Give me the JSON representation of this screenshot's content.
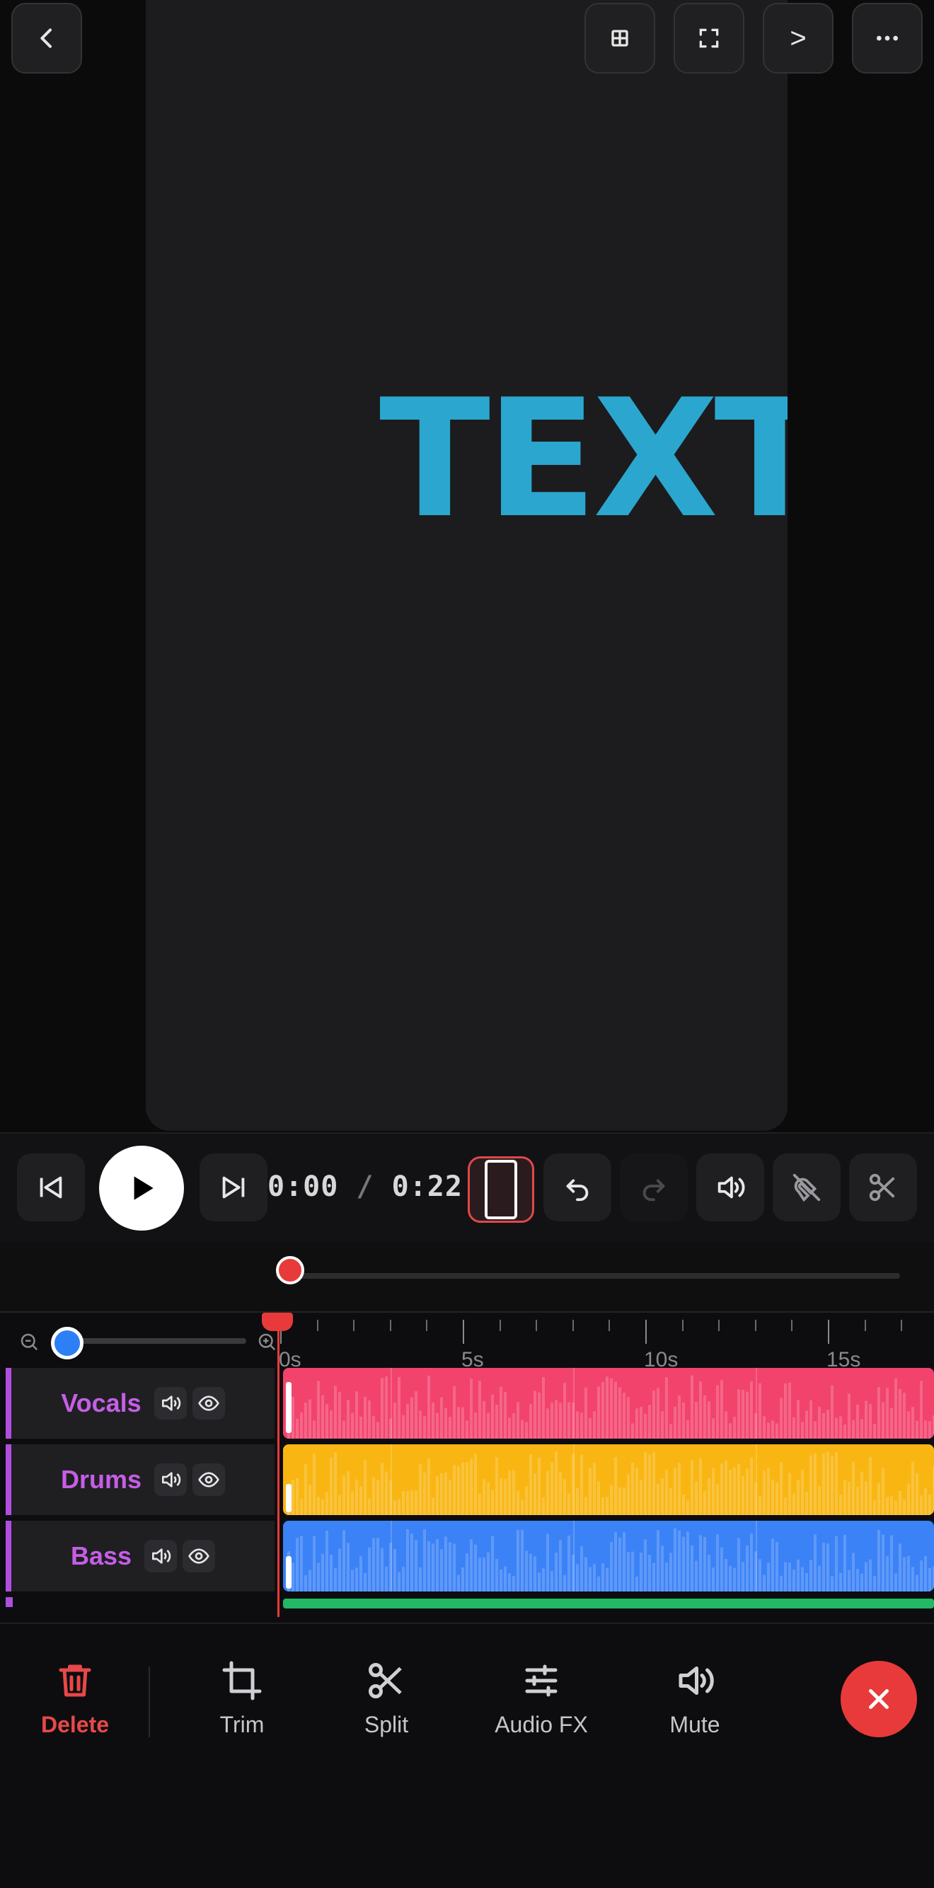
{
  "preview": {
    "overlay_text": "TEXT",
    "top_buttons": [
      "back",
      "grid",
      "fullscreen",
      "next",
      "more"
    ],
    "next_label": ">"
  },
  "transport": {
    "current_time": "0:00",
    "separator": " / ",
    "total_time": "0:22"
  },
  "ruler": {
    "labels": [
      "0s",
      "5s",
      "10s",
      "15s"
    ]
  },
  "tracks": [
    {
      "name": "Vocals",
      "color": "#f2436d"
    },
    {
      "name": "Drums",
      "color": "#f9b612"
    },
    {
      "name": "Bass",
      "color": "#3b82f6"
    }
  ],
  "extra_lane_color": "#22b866",
  "actions": {
    "delete": "Delete",
    "trim": "Trim",
    "split": "Split",
    "audio_fx": "Audio FX",
    "mute": "Mute"
  },
  "colors": {
    "accent_red": "#e83a3a",
    "track_label": "#c55ee6"
  }
}
